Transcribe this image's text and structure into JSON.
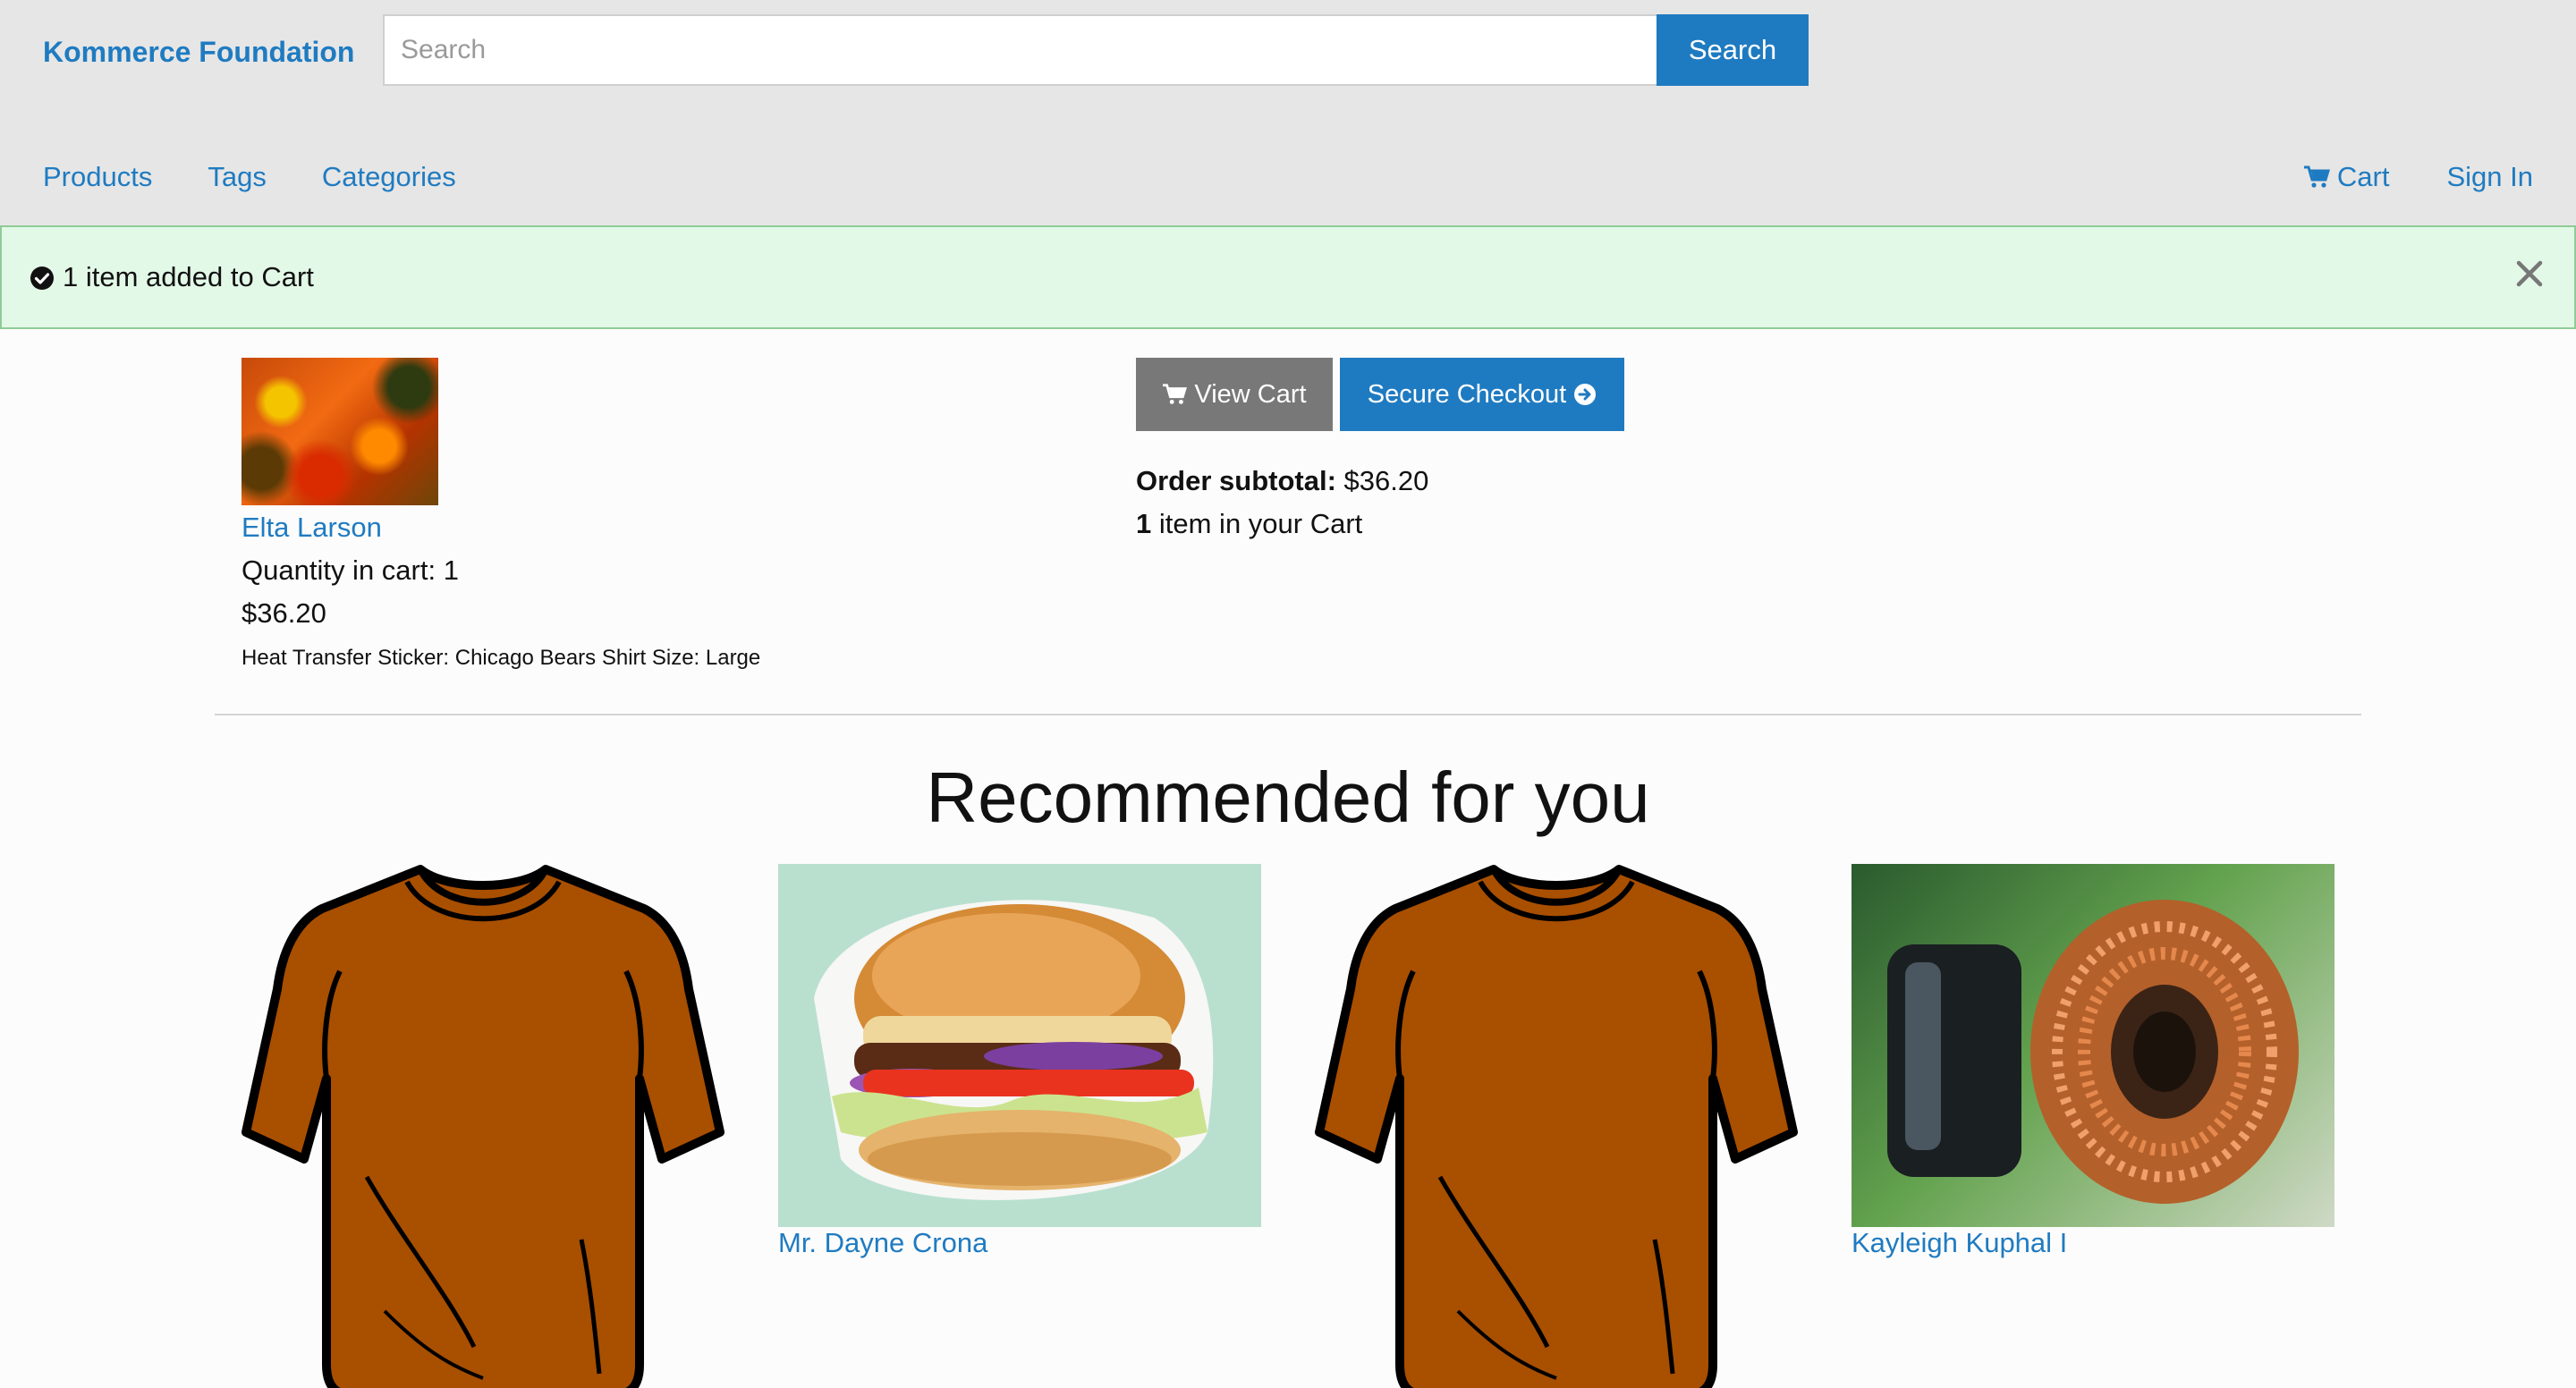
{
  "header": {
    "brand": "Kommerce Foundation",
    "search_placeholder": "Search",
    "search_button": "Search",
    "nav_left": [
      "Products",
      "Tags",
      "Categories"
    ],
    "cart_label": "Cart",
    "sign_in": "Sign In"
  },
  "alert": {
    "message": "1 item added to Cart"
  },
  "cart_item": {
    "name": "Elta Larson",
    "quantity_text": "Quantity in cart: 1",
    "price": "$36.20",
    "options": "Heat Transfer Sticker: Chicago Bears Shirt Size: Large"
  },
  "summary": {
    "view_cart": "View Cart",
    "secure_checkout": "Secure Checkout",
    "subtotal_label": "Order subtotal:",
    "subtotal_value": "$36.20",
    "count": "1",
    "count_suffix": "item in your Cart"
  },
  "recommended": {
    "title": "Recommended for you",
    "items": [
      {
        "name": "",
        "image": "orange-tshirt"
      },
      {
        "name": "Mr. Dayne Crona",
        "image": "burger"
      },
      {
        "name": "",
        "image": "orange-tshirt"
      },
      {
        "name": "Kayleigh Kuphal I",
        "image": "copper-coil"
      }
    ]
  },
  "colors": {
    "link": "#1f7bc1",
    "header_bg": "#e6e6e6",
    "alert_bg": "#e3f9e7",
    "alert_border": "#8fcc98",
    "view_cart_bg": "#787878",
    "tshirt": "#a94f00"
  }
}
